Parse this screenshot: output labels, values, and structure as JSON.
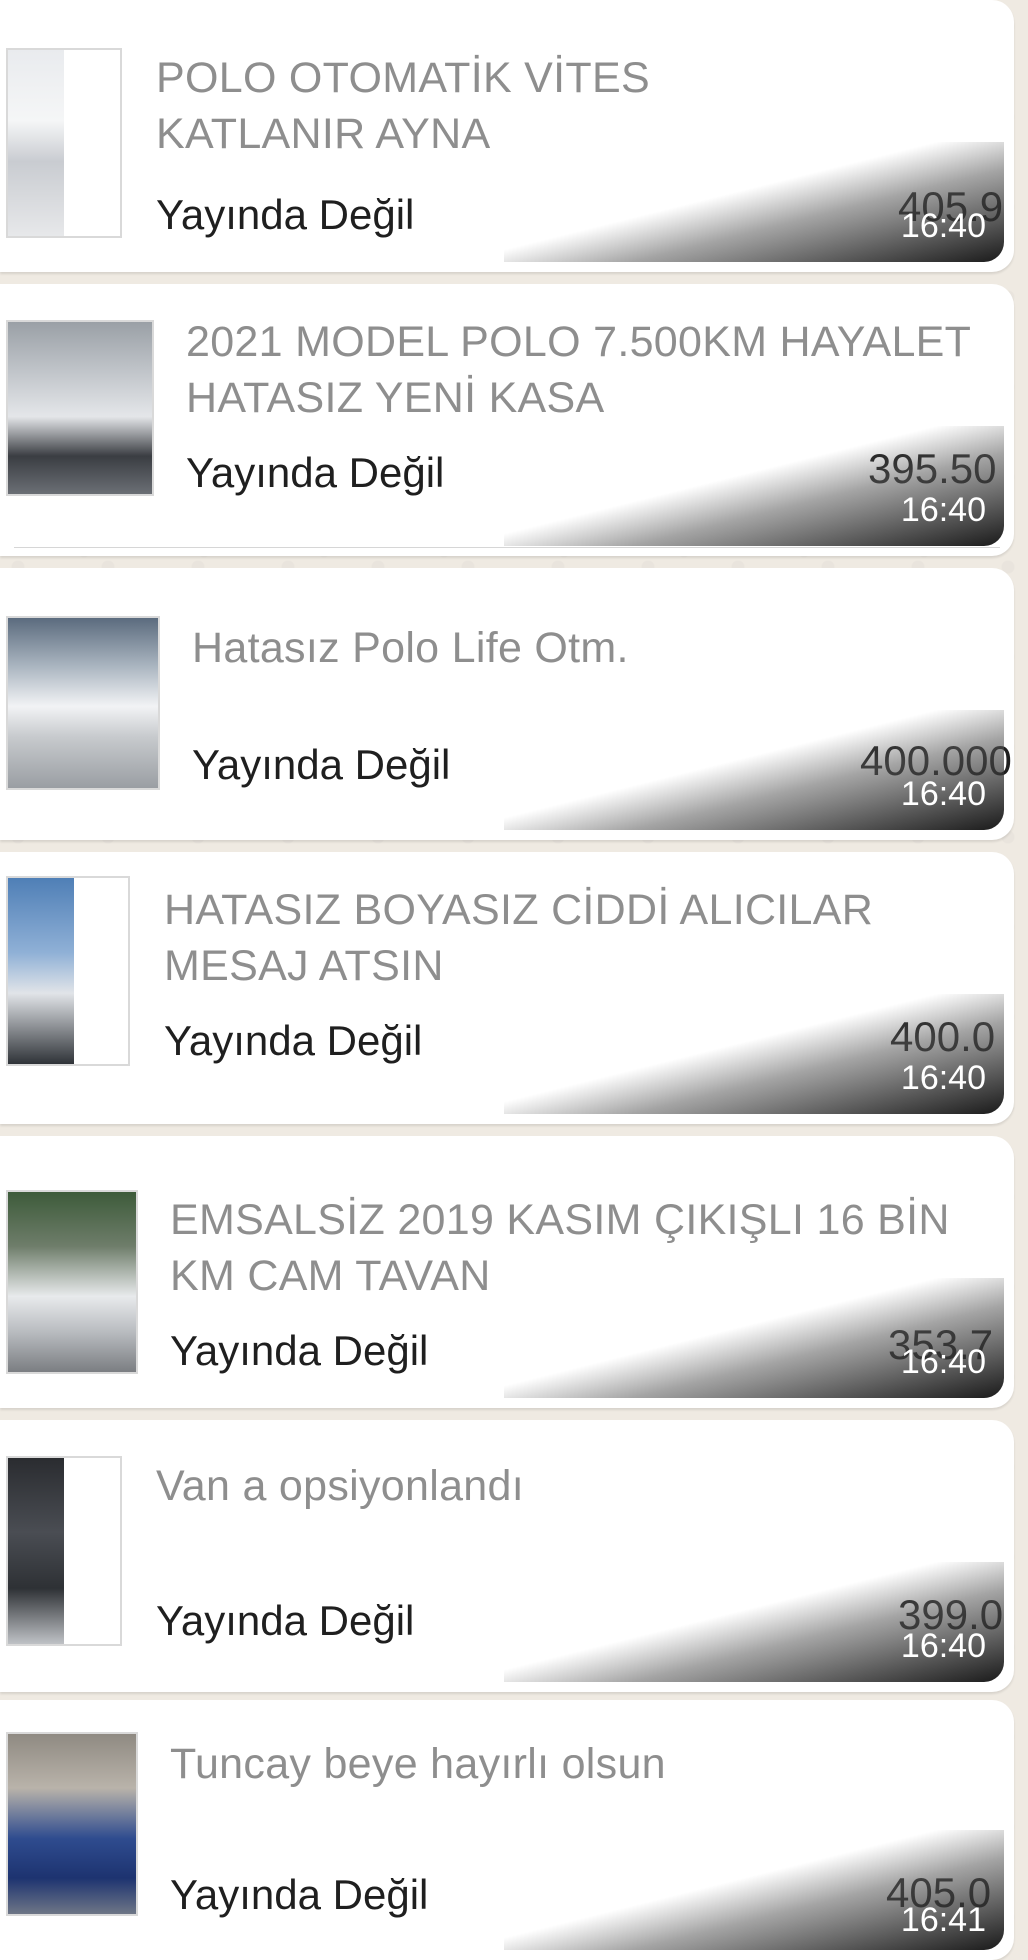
{
  "status_label": "Yayında Değil",
  "messages": [
    {
      "title": "POLO OTOMATİK VİTES\nKATLANIR AYNA",
      "price": "405.9",
      "time": "16:40"
    },
    {
      "title": "2021 MODEL POLO 7.500KM HAYALET\nHATASIZ YENİ KASA",
      "price": "395.50",
      "time": "16:40"
    },
    {
      "title": "Hatasız Polo Life Otm.",
      "price": "400.000",
      "time": "16:40"
    },
    {
      "title": "HATASIZ BOYASIZ CİDDİ ALICILAR\nMESAJ ATSIN",
      "price": "400.0",
      "time": "16:40"
    },
    {
      "title": "EMSALSİZ 2019 KASIM ÇIKIŞLI 16 BİN\nKM CAM TAVAN",
      "price": "353.7",
      "time": "16:40"
    },
    {
      "title": "Van a opsiyonlandı",
      "price": "399.0",
      "time": "16:40"
    },
    {
      "title": "Tuncay beye hayırlı olsun",
      "price": "405.0",
      "time": "16:41"
    }
  ]
}
